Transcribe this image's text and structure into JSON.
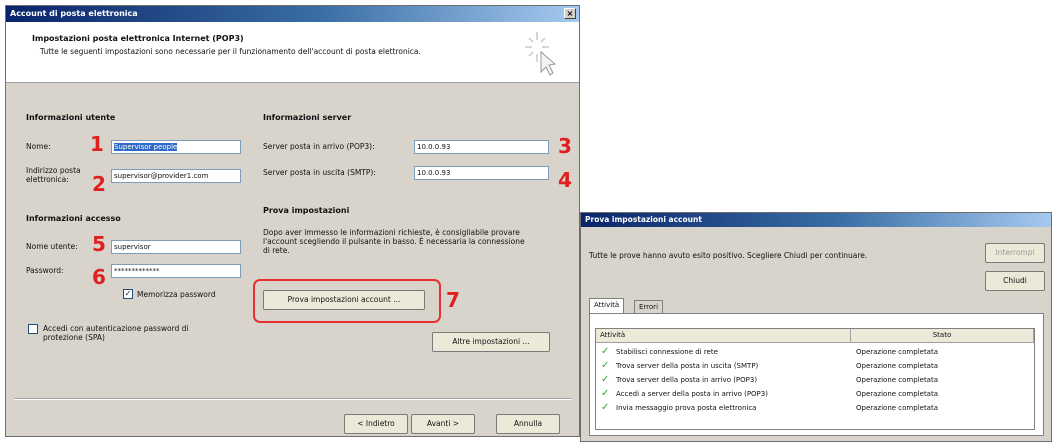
{
  "main": {
    "title": "Account di posta elettronica",
    "close": "×",
    "header_title": "Impostazioni posta elettronica Internet (POP3)",
    "header_desc": "Tutte le seguenti impostazioni sono necessarie per il funzionamento dell'account di posta elettronica.",
    "user_info": {
      "heading": "Informazioni utente",
      "name_label": "Nome:",
      "name_value": "Supervisor people",
      "email_label": "Indirizzo posta elettronica:",
      "email_value": "supervisor@provider1.com"
    },
    "server_info": {
      "heading": "Informazioni server",
      "incoming_label": "Server posta in arrivo (POP3):",
      "incoming_value": "10.0.0.93",
      "outgoing_label": "Server posta in uscita (SMTP):",
      "outgoing_value": "10.0.0.93"
    },
    "logon_info": {
      "heading": "Informazioni accesso",
      "user_label": "Nome utente:",
      "user_value": "supervisor",
      "password_label": "Password:",
      "password_value": "*************",
      "remember_label": "Memorizza password",
      "spa_label": "Accedi con autenticazione password di protezione (SPA)"
    },
    "test": {
      "heading": "Prova impostazioni",
      "desc": "Dopo aver immesso le informazioni richieste, è consigliabile provare l'account scegliendo il pulsante in basso. È necessaria la connessione di rete.",
      "button": "Prova impostazioni account ...",
      "more_button": "Altre impostazioni ..."
    },
    "nav": {
      "back": "< Indietro",
      "next": "Avanti >",
      "cancel": "Annulla"
    },
    "markers": [
      "1",
      "2",
      "3",
      "4",
      "5",
      "6",
      "7"
    ]
  },
  "test_dialog": {
    "title": "Prova impostazioni account",
    "message": "Tutte le prove hanno avuto esito positivo. Scegliere Chiudi per continuare.",
    "stop_button": "Interrompi",
    "close_button": "Chiudi",
    "tabs": [
      "Attività",
      "Errori"
    ],
    "columns": [
      "Attività",
      "Stato"
    ],
    "rows": [
      {
        "task": "Stabilisci connessione di rete",
        "status": "Operazione completata"
      },
      {
        "task": "Trova server della posta in uscita (SMTP)",
        "status": "Operazione completata"
      },
      {
        "task": "Trova server della posta in arrivo (POP3)",
        "status": "Operazione completata"
      },
      {
        "task": "Accedi a server della posta in arrivo (POP3)",
        "status": "Operazione completata"
      },
      {
        "task": "Invia messaggio prova posta elettronica",
        "status": "Operazione completata"
      }
    ]
  },
  "colors": {
    "title_bar": "#0a246a",
    "annotation": "#e02020",
    "check": "#2aa52a"
  }
}
